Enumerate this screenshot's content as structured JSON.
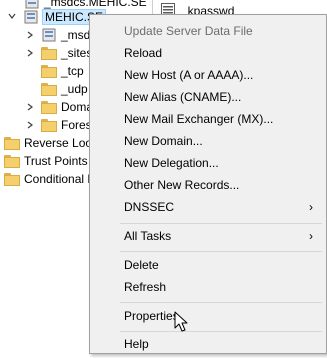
{
  "tree": {
    "items": [
      {
        "label": "_msdcs.MEHIC.SE",
        "icon": "zone-icon"
      },
      {
        "label": "MEHIC.SE",
        "icon": "zone-icon"
      },
      {
        "label": "_msdcs",
        "icon": "folder-icon"
      },
      {
        "label": "_sites",
        "icon": "folder-icon"
      },
      {
        "label": "_tcp",
        "icon": "folder-icon"
      },
      {
        "label": "_udp",
        "icon": "folder-icon"
      },
      {
        "label": "DomainDnsZones",
        "icon": "folder-icon"
      },
      {
        "label": "ForestDnsZones",
        "icon": "folder-icon"
      },
      {
        "label": "Reverse Lookup Zones",
        "icon": "folder-icon"
      },
      {
        "label": "Trust Points",
        "icon": "folder-icon"
      },
      {
        "label": "Conditional Forwarders",
        "icon": "folder-icon"
      }
    ]
  },
  "right_pane": {
    "file_label": "_kpasswd"
  },
  "context_menu": {
    "items": [
      {
        "label": "Update Server Data File",
        "disabled": true
      },
      {
        "label": "Reload"
      },
      {
        "label": "New Host (A or AAAA)..."
      },
      {
        "label": "New Alias (CNAME)..."
      },
      {
        "label": "New Mail Exchanger (MX)..."
      },
      {
        "label": "New Domain..."
      },
      {
        "label": "New Delegation..."
      },
      {
        "label": "Other New Records..."
      },
      {
        "label": "DNSSEC",
        "submenu": true
      },
      {
        "label": "All Tasks",
        "submenu": true
      },
      {
        "label": "Delete"
      },
      {
        "label": "Refresh"
      },
      {
        "label": "Properties"
      },
      {
        "label": "Help"
      }
    ],
    "submenu_arrow": "›"
  }
}
